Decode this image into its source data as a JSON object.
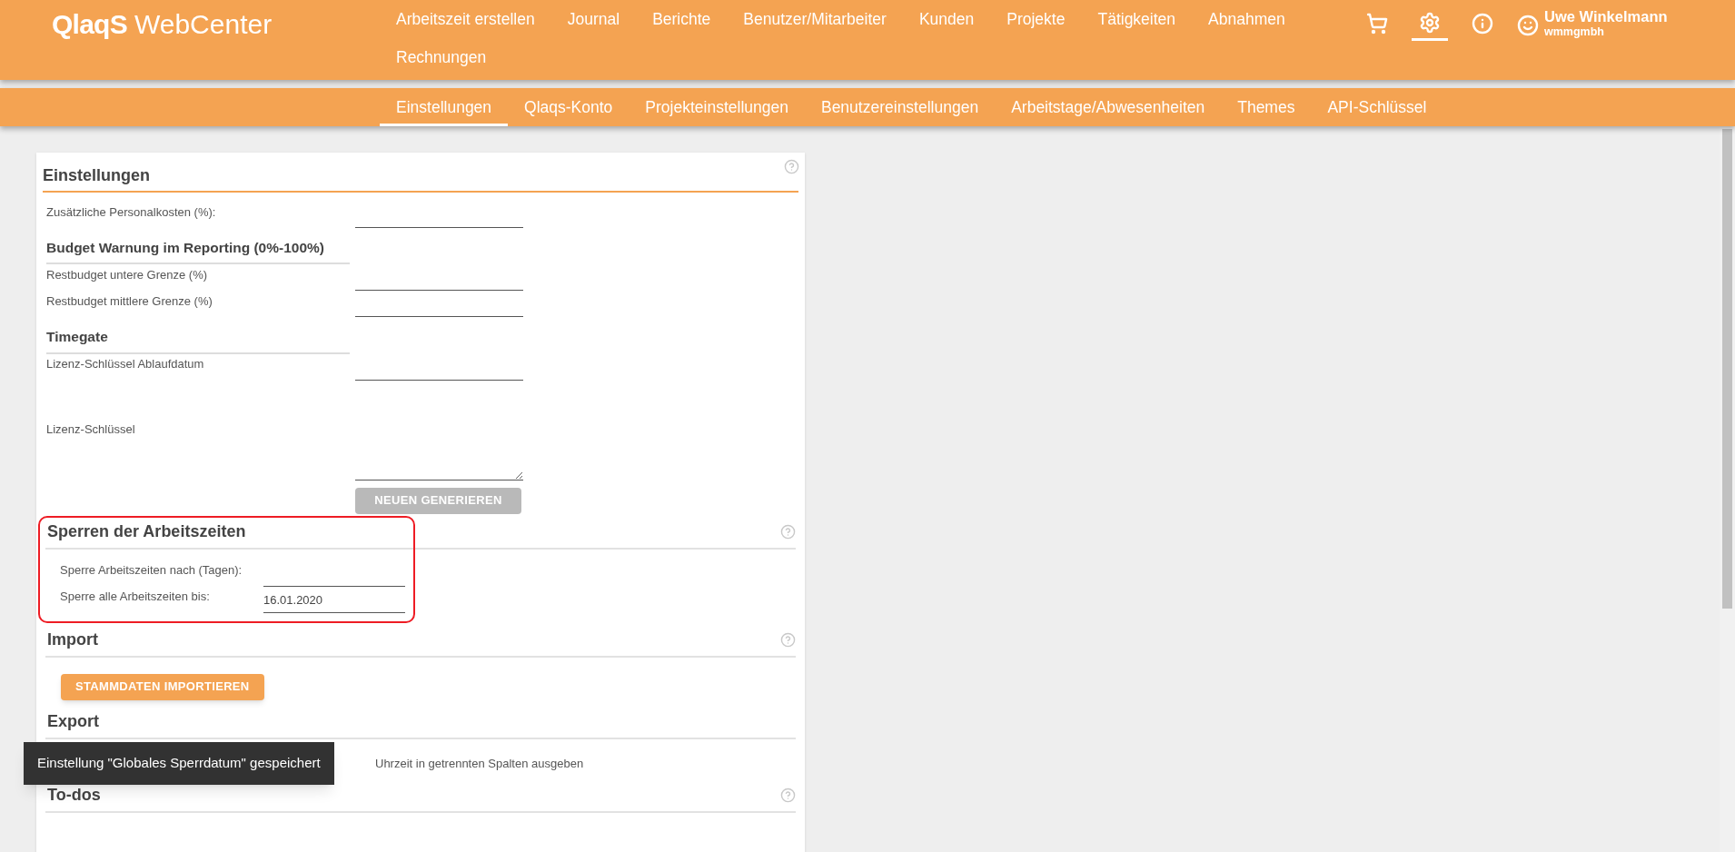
{
  "header": {
    "logo": {
      "mark": "QlaqS",
      "name": "WebCenter"
    },
    "nav": [
      {
        "label": "Arbeitszeit erstellen"
      },
      {
        "label": "Journal"
      },
      {
        "label": "Berichte"
      },
      {
        "label": "Benutzer/Mitarbeiter"
      },
      {
        "label": "Kunden"
      },
      {
        "label": "Projekte"
      },
      {
        "label": "Tätigkeiten"
      },
      {
        "label": "Abnahmen"
      },
      {
        "label": "Rechnungen"
      }
    ],
    "icons": [
      {
        "kind": "cart",
        "selected": false
      },
      {
        "kind": "settings",
        "selected": true
      },
      {
        "kind": "info",
        "selected": false
      }
    ],
    "user": {
      "name": "Uwe Winkelmann",
      "company": "wmmgmbh"
    }
  },
  "subnav": [
    {
      "label": "Einstellungen",
      "selected": true
    },
    {
      "label": "Qlaqs-Konto",
      "selected": false
    },
    {
      "label": "Projekteinstellungen",
      "selected": false
    },
    {
      "label": "Benutzereinstellungen",
      "selected": false
    },
    {
      "label": "Arbeitstage/Abwesenheiten",
      "selected": false
    },
    {
      "label": "Themes",
      "selected": false
    },
    {
      "label": "API-Schlüssel",
      "selected": false
    }
  ],
  "sections": [
    {
      "kind": "main",
      "title": "Einstellungen",
      "help": true,
      "highlighted": false,
      "items": [
        {
          "kind": "field",
          "label": "Zusätzliche Personalkosten (%):"
        },
        {
          "kind": "subheading",
          "label": "Budget Warnung im Reporting (0%-100%)"
        },
        {
          "kind": "field",
          "label": "Restbudget untere Grenze (%)"
        },
        {
          "kind": "field",
          "label": "Restbudget mittlere Grenze (%)"
        },
        {
          "kind": "subheading",
          "label": "Timegate"
        },
        {
          "kind": "field",
          "label": "Lizenz-Schlüssel Ablaufdatum"
        },
        {
          "kind": "textarea",
          "label": "Lizenz-Schlüssel"
        },
        {
          "kind": "button",
          "label": "NEUEN GENERIEREN",
          "disabled": true
        }
      ]
    },
    {
      "kind": "panel",
      "title": "Sperren der Arbeitszeiten",
      "help": true,
      "highlighted": true,
      "items": [
        {
          "kind": "field",
          "label": "Sperre Arbeitszeiten nach (Tagen):"
        },
        {
          "kind": "field",
          "label": "Sperre alle Arbeitszeiten bis:",
          "value": "16.01.2020"
        }
      ]
    },
    {
      "kind": "panel",
      "title": "Import",
      "help": true,
      "highlighted": false,
      "items": [
        {
          "kind": "button",
          "label": "STAMMDATEN IMPORTIEREN",
          "disabled": false
        }
      ]
    },
    {
      "kind": "panel",
      "title": "Export",
      "help": false,
      "highlighted": false,
      "items": [
        {
          "kind": "text",
          "label": "Uhrzeit in getrennten Spalten ausgeben"
        }
      ]
    },
    {
      "kind": "panel",
      "title": "To-dos",
      "help": true,
      "highlighted": false
    }
  ],
  "toast": {
    "text": "Einstellung \"Globales Sperrdatum\" gespeichert"
  }
}
